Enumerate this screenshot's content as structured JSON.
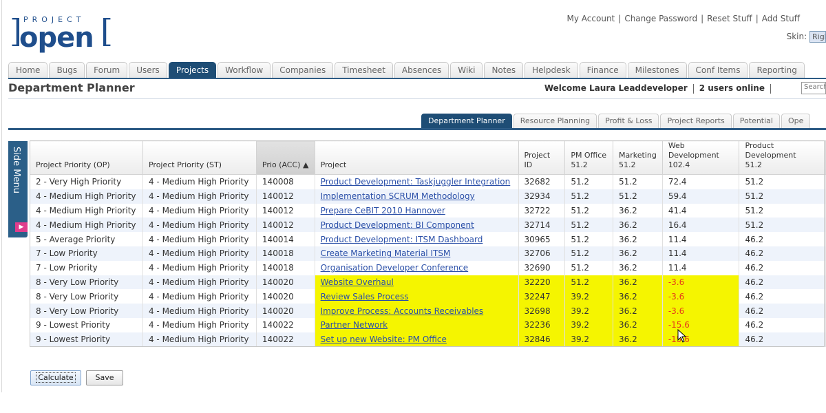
{
  "logo": {
    "small_text": "PROJECT",
    "big_text": "open"
  },
  "top_links": [
    "My Account",
    "Change Password",
    "Reset Stuff",
    "Add Stuff"
  ],
  "skin": {
    "label": "Skin:",
    "value": "Right"
  },
  "main_tabs": [
    "Home",
    "Bugs",
    "Forum",
    "Users",
    "Projects",
    "Workflow",
    "Companies",
    "Timesheet",
    "Absences",
    "Wiki",
    "Notes",
    "Helpdesk",
    "Finance",
    "Milestones",
    "Conf Items",
    "Reporting"
  ],
  "active_main_tab": "Projects",
  "page_title": "Department Planner",
  "welcome_text": "Welcome Laura Leaddeveloper",
  "users_online": "2 users online",
  "search_placeholder": "Search",
  "sub_tabs": [
    "Department Planner",
    "Resource Planning",
    "Profit & Loss",
    "Project Reports",
    "Potential",
    "Ope"
  ],
  "active_sub_tab": "Department Planner",
  "side_menu_label": "Side Menu",
  "table": {
    "headers": [
      {
        "line1": "Project Priority (OP)",
        "line2": ""
      },
      {
        "line1": "Project Priority (ST)",
        "line2": ""
      },
      {
        "line1": "Prio (ACC)",
        "line2": ""
      },
      {
        "line1": "Project",
        "line2": ""
      },
      {
        "line1": "Project ID",
        "line2": ""
      },
      {
        "line1": "PM Office",
        "line2": "51.2"
      },
      {
        "line1": "Marketing",
        "line2": "51.2"
      },
      {
        "line1": "Web Development",
        "line2": "102.4"
      },
      {
        "line1": "Product Development",
        "line2": "51.2"
      }
    ],
    "rows": [
      {
        "op": "2 - Very High Priority",
        "st": "4 - Medium High Priority",
        "acc": "140008",
        "project": "Product Development: Taskjuggler Integration",
        "id": "32682",
        "pm": "51.2",
        "mkt": "51.2",
        "web": "72.4",
        "prod": "51.2",
        "highlight": false,
        "neg": false
      },
      {
        "op": "4 - Medium High Priority",
        "st": "4 - Medium High Priority",
        "acc": "140012",
        "project": "Implementation SCRUM Methodology",
        "id": "32934",
        "pm": "51.2",
        "mkt": "51.2",
        "web": "59.4",
        "prod": "51.2",
        "highlight": false,
        "neg": false
      },
      {
        "op": "4 - Medium High Priority",
        "st": "4 - Medium High Priority",
        "acc": "140012",
        "project": "Prepare CeBIT 2010 Hannover",
        "id": "32722",
        "pm": "51.2",
        "mkt": "36.2",
        "web": "41.4",
        "prod": "51.2",
        "highlight": false,
        "neg": false
      },
      {
        "op": "4 - Medium High Priority",
        "st": "4 - Medium High Priority",
        "acc": "140012",
        "project": "Product Development: BI Component",
        "id": "32714",
        "pm": "51.2",
        "mkt": "36.2",
        "web": "16.4",
        "prod": "51.2",
        "highlight": false,
        "neg": false
      },
      {
        "op": "5 - Average Priority",
        "st": "4 - Medium High Priority",
        "acc": "140014",
        "project": "Product Development: ITSM Dashboard",
        "id": "30965",
        "pm": "51.2",
        "mkt": "36.2",
        "web": "11.4",
        "prod": "46.2",
        "highlight": false,
        "neg": false
      },
      {
        "op": "7 - Low Priority",
        "st": "4 - Medium High Priority",
        "acc": "140018",
        "project": "Create Marketing Material ITSM",
        "id": "32706",
        "pm": "51.2",
        "mkt": "36.2",
        "web": "11.4",
        "prod": "46.2",
        "highlight": false,
        "neg": false
      },
      {
        "op": "7 - Low Priority",
        "st": "4 - Medium High Priority",
        "acc": "140018",
        "project": "Organisation Developer Conference",
        "id": "32690",
        "pm": "51.2",
        "mkt": "36.2",
        "web": "11.4",
        "prod": "46.2",
        "highlight": false,
        "neg": false
      },
      {
        "op": "8 - Very Low Priority",
        "st": "4 - Medium High Priority",
        "acc": "140020",
        "project": "Website Overhaul",
        "id": "32220",
        "pm": "51.2",
        "mkt": "36.2",
        "web": "-3.6",
        "prod": "46.2",
        "highlight": true,
        "neg": true
      },
      {
        "op": "8 - Very Low Priority",
        "st": "4 - Medium High Priority",
        "acc": "140020",
        "project": "Review Sales Process",
        "id": "32247",
        "pm": "39.2",
        "mkt": "36.2",
        "web": "-3.6",
        "prod": "46.2",
        "highlight": true,
        "neg": true
      },
      {
        "op": "8 - Very Low Priority",
        "st": "4 - Medium High Priority",
        "acc": "140020",
        "project": "Improve Process: Accounts Receivables",
        "id": "32698",
        "pm": "39.2",
        "mkt": "36.2",
        "web": "-3.6",
        "prod": "46.2",
        "highlight": true,
        "neg": true
      },
      {
        "op": "9 - Lowest Priority",
        "st": "4 - Medium High Priority",
        "acc": "140022",
        "project": "Partner Network",
        "id": "32236",
        "pm": "39.2",
        "mkt": "36.2",
        "web": "-15.6",
        "prod": "46.2",
        "highlight": true,
        "neg": true
      },
      {
        "op": "9 - Lowest Priority",
        "st": "4 - Medium High Priority",
        "acc": "140022",
        "project": "Set up new Website: PM Office",
        "id": "32846",
        "pm": "39.2",
        "mkt": "36.2",
        "web": "-15.6",
        "prod": "46.2",
        "highlight": true,
        "neg": true
      }
    ]
  },
  "buttons": {
    "calculate": "Calculate",
    "save": "Save"
  },
  "colors": {
    "nav_active": "#1e4d75",
    "highlight": "#f5f500",
    "negative": "#e53a1a",
    "link": "#2a4fa8",
    "side_menu": "#2b5f88"
  },
  "icons": {
    "sort": "triangle-up",
    "side_menu_toggle": "arrow-right"
  }
}
